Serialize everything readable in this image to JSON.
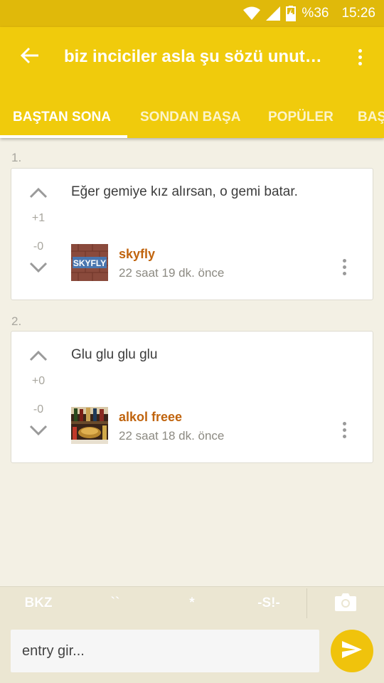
{
  "status_bar": {
    "battery": "%36",
    "time": "15:26"
  },
  "app_bar": {
    "title": "biz inciciler asla şu sözü unutmayacağız",
    "tabs": [
      {
        "label": "BAŞTAN SONA",
        "active": true
      },
      {
        "label": "SONDAN BAŞA",
        "active": false
      },
      {
        "label": "POPÜLER",
        "active": false
      },
      {
        "label": "BAŞ",
        "active": false
      }
    ]
  },
  "entries": [
    {
      "number": "1.",
      "text": "Eğer gemiye kız alırsan, o gemi batar.",
      "upvotes": "+1",
      "downvotes": "-0",
      "author": "skyfly",
      "time": "22 saat 19 dk. önce",
      "avatar_text": "SKYFLY"
    },
    {
      "number": "2.",
      "text": "Glu glu glu glu",
      "upvotes": "+0",
      "downvotes": "-0",
      "author": "alkol freee",
      "time": "22 saat 18 dk. önce"
    }
  ],
  "shortcuts": [
    "BKZ",
    "``",
    "*",
    "-S!-"
  ],
  "composer": {
    "placeholder": "entry gir..."
  },
  "colors": {
    "app_bar": "#f0cb0c",
    "status_bar": "#e0b90a",
    "author": "#c0640e",
    "send_button": "#f0c30c",
    "background": "#f3f0e4"
  },
  "icons": [
    "wifi-icon",
    "signal-icon",
    "battery-icon",
    "back-arrow-icon",
    "more-vert-icon",
    "chevron-up-icon",
    "chevron-down-icon",
    "camera-icon",
    "send-icon"
  ]
}
